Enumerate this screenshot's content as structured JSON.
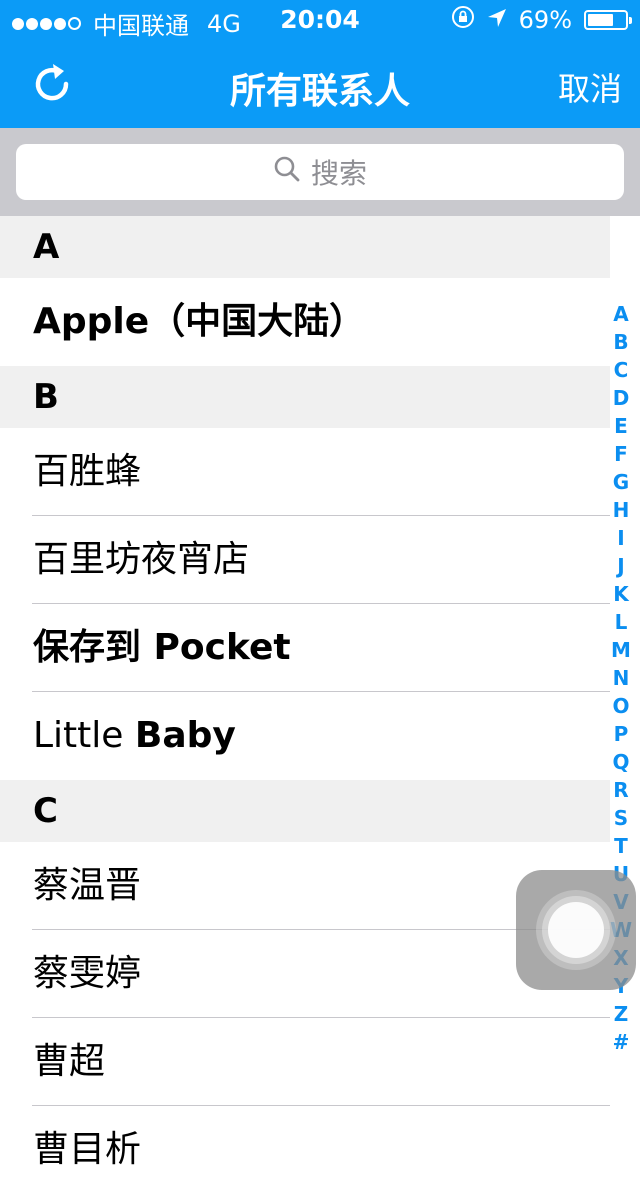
{
  "status_bar": {
    "signal_dots_filled": 4,
    "carrier": "中国联通",
    "network": "4G",
    "time": "20:04",
    "battery_percent": "69%",
    "battery_level": 0.69
  },
  "nav": {
    "title": "所有联系人",
    "cancel_label": "取消"
  },
  "search": {
    "placeholder": "搜索"
  },
  "sections": [
    {
      "letter": "A",
      "contacts": [
        {
          "name": "Apple（中国大陆）"
        }
      ]
    },
    {
      "letter": "B",
      "contacts": [
        {
          "name": "百胜蜂"
        },
        {
          "name": "百里坊夜宵店"
        },
        {
          "name": "保存到 Pocket"
        },
        {
          "first": "Little",
          "last": "Baby"
        }
      ]
    },
    {
      "letter": "C",
      "contacts": [
        {
          "name": "蔡温晋"
        },
        {
          "name": "蔡雯婷"
        },
        {
          "name": "曹超"
        },
        {
          "name": "曹目析"
        }
      ]
    }
  ],
  "index_letters": [
    "A",
    "B",
    "C",
    "D",
    "E",
    "F",
    "G",
    "H",
    "I",
    "J",
    "K",
    "L",
    "M",
    "N",
    "O",
    "P",
    "Q",
    "R",
    "S",
    "T",
    "U",
    "V",
    "W",
    "X",
    "Y",
    "Z",
    "#"
  ],
  "colors": {
    "nav_blue": "#0b9bf7",
    "index_blue": "#0b8ef0",
    "section_bg": "#f0f0f0",
    "search_area_bg": "#c9c9ce"
  }
}
